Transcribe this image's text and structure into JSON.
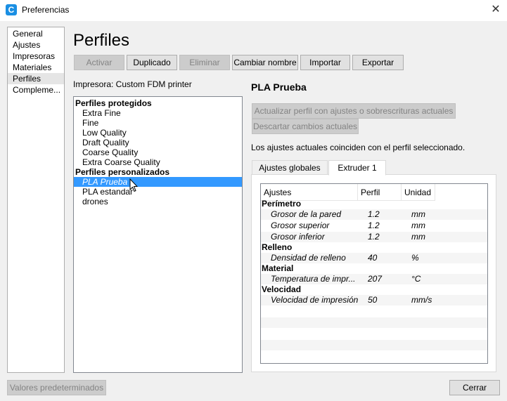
{
  "window": {
    "title": "Preferencias",
    "close_glyph": "✕",
    "icon_letter": "C"
  },
  "nav": {
    "items": [
      {
        "label": "General"
      },
      {
        "label": "Ajustes"
      },
      {
        "label": "Impresoras"
      },
      {
        "label": "Materiales"
      },
      {
        "label": "Perfiles"
      },
      {
        "label": "Compleme..."
      }
    ],
    "selected_index": 4
  },
  "page": {
    "title": "Perfiles"
  },
  "toolbar": {
    "activate": "Activar",
    "duplicate": "Duplicado",
    "delete": "Eliminar",
    "rename": "Cambiar nombre",
    "import": "Importar",
    "export": "Exportar"
  },
  "printer": {
    "label": "Impresora: Custom FDM printer"
  },
  "profiles": {
    "protected_header": "Perfiles protegidos",
    "protected": [
      "Extra Fine",
      "Fine",
      "Low Quality",
      "Draft Quality",
      "Coarse Quality",
      "Extra Coarse Quality"
    ],
    "custom_header": "Perfiles personalizados",
    "custom": [
      "PLA Prueba",
      "PLA estandar",
      "drones"
    ],
    "selected": "PLA Prueba"
  },
  "detail": {
    "name": "PLA Prueba",
    "update_button": "Actualizar perfil con ajustes o sobrescrituras actuales",
    "discard_button": "Descartar cambios actuales",
    "status": "Los ajustes actuales coinciden con el perfil seleccionado.",
    "tabs": [
      "Ajustes globales",
      "Extruder 1"
    ],
    "active_tab": 1
  },
  "settings_table": {
    "headers": [
      "Ajustes",
      "Perfil",
      "Unidad"
    ],
    "rows": [
      {
        "group": "Perímetro"
      },
      {
        "name": "Grosor de la pared",
        "value": "1.2",
        "unit": "mm"
      },
      {
        "name": "Grosor superior",
        "value": "1.2",
        "unit": "mm"
      },
      {
        "name": "Grosor inferior",
        "value": "1.2",
        "unit": "mm"
      },
      {
        "group": "Relleno"
      },
      {
        "name": "Densidad de relleno",
        "value": "40",
        "unit": "%"
      },
      {
        "group": "Material"
      },
      {
        "name": "Temperatura de impr...",
        "value": "207",
        "unit": "°C"
      },
      {
        "group": "Velocidad"
      },
      {
        "name": "Velocidad de impresión",
        "value": "50",
        "unit": "mm/s"
      }
    ]
  },
  "footer": {
    "defaults_button": "Valores predeterminados",
    "close_button": "Cerrar"
  },
  "colors": {
    "selection": "#3399ff",
    "app_icon": "#1a8fe3"
  }
}
